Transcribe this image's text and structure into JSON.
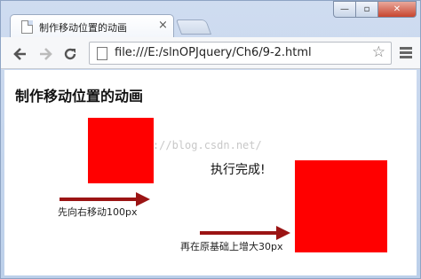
{
  "browser": {
    "tab_title": "制作移动位置的动画",
    "tab_close": "×",
    "url": "file:///E:/slnOPJquery/Ch6/9-2.html",
    "window_buttons": {
      "minimize": "—",
      "maximize": "▫",
      "close": "✕"
    },
    "icons": {
      "back": "back-arrow-icon",
      "forward": "forward-arrow-icon",
      "reload": "reload-icon",
      "star": "star-icon",
      "menu": "hamburger-menu-icon"
    }
  },
  "page": {
    "heading": "制作移动位置的动画",
    "watermark": "http://blog.csdn.net/",
    "status": "执行完成!",
    "step1_caption": "先向右移动100px",
    "step2_caption": "再在原基础上增大30px",
    "box_color": "#ff0000",
    "arrow_color": "#9b1414"
  }
}
